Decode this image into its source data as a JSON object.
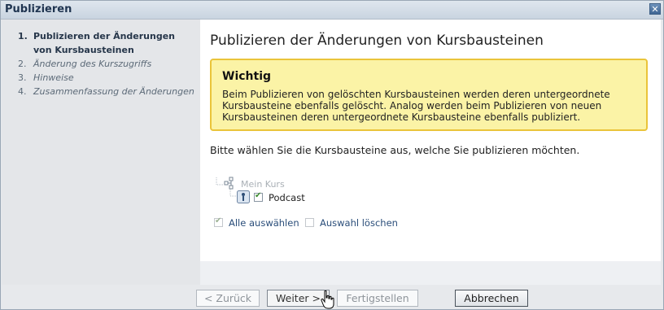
{
  "window": {
    "title": "Publizieren"
  },
  "steps": [
    {
      "num": "1.",
      "label": "Publizieren der Änderungen von Kursbausteinen",
      "state": "active"
    },
    {
      "num": "2.",
      "label": "Änderung des Kurszugriffs",
      "state": "inactive"
    },
    {
      "num": "3.",
      "label": "Hinweise",
      "state": "inactive"
    },
    {
      "num": "4.",
      "label": "Zusammenfassung der Änderungen",
      "state": "inactive"
    }
  ],
  "main": {
    "heading": "Publizieren der Änderungen von Kursbausteinen",
    "warning": {
      "title": "Wichtig",
      "text": "Beim Publizieren von gelöschten Kursbausteinen werden deren untergeordnete Kursbausteine ebenfalls gelöscht. Analog werden beim Publizieren von neuen Kursbausteinen deren untergeordnete Kursbausteine ebenfalls publiziert."
    },
    "instruction": "Bitte wählen Sie die Kursbausteine aus, welche Sie publizieren möchten.",
    "tree": {
      "root": "Mein Kurs",
      "child": {
        "label": "Podcast",
        "checked": true
      }
    },
    "actions": {
      "select_all": "Alle auswählen",
      "deselect": "Auswahl löschen"
    }
  },
  "footer": {
    "back": "< Zurück",
    "next": "Weiter >",
    "finish": "Fertigstellen",
    "cancel": "Abbrechen"
  },
  "colors": {
    "warning_bg": "#fbf3a6",
    "warning_border": "#eac43a",
    "link": "#2b4e7a"
  }
}
